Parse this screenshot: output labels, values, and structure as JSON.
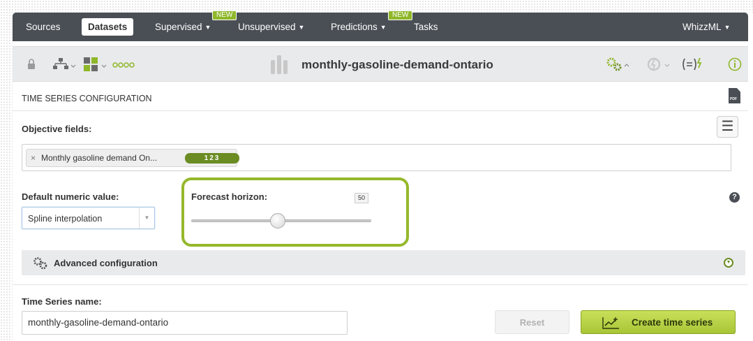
{
  "nav": {
    "items": [
      {
        "label": "Sources",
        "active": false
      },
      {
        "label": "Datasets",
        "active": true
      },
      {
        "label": "Supervised",
        "dropdown": true,
        "badge": "NEW"
      },
      {
        "label": "Unsupervised",
        "dropdown": true
      },
      {
        "label": "Predictions",
        "dropdown": true,
        "badge": "NEW"
      },
      {
        "label": "Tasks"
      }
    ],
    "right": {
      "label": "WhizzML",
      "dropdown": true
    },
    "caret": "▼"
  },
  "toolbar": {
    "resource_name": "monthly-gasoline-demand-ontario",
    "icons": [
      "lock-icon",
      "model-tree-icon",
      "dataset-ops-icon",
      "more-dots-icon",
      "configure-gears-icon",
      "one-click-icon",
      "flatline-icon",
      "info-icon"
    ]
  },
  "config": {
    "section_title": "TIME SERIES CONFIGURATION",
    "objective_label": "Objective fields:",
    "objective_tag": {
      "text": "Monthly gasoline demand On...",
      "type": "123"
    },
    "default_numeric_label": "Default numeric value:",
    "default_numeric_value": "Spline interpolation",
    "forecast_label": "Forecast horizon:",
    "forecast_value": "50",
    "forecast_fraction": 0.48,
    "advanced_label": "Advanced configuration",
    "name_label": "Time Series name:",
    "name_value": "monthly-gasoline-demand-ontario"
  },
  "buttons": {
    "reset": "Reset",
    "create": "Create time series"
  },
  "colors": {
    "nav_bg": "#4a4f55",
    "accent_green": "#95b82b",
    "type_badge": "#6b8c23"
  }
}
